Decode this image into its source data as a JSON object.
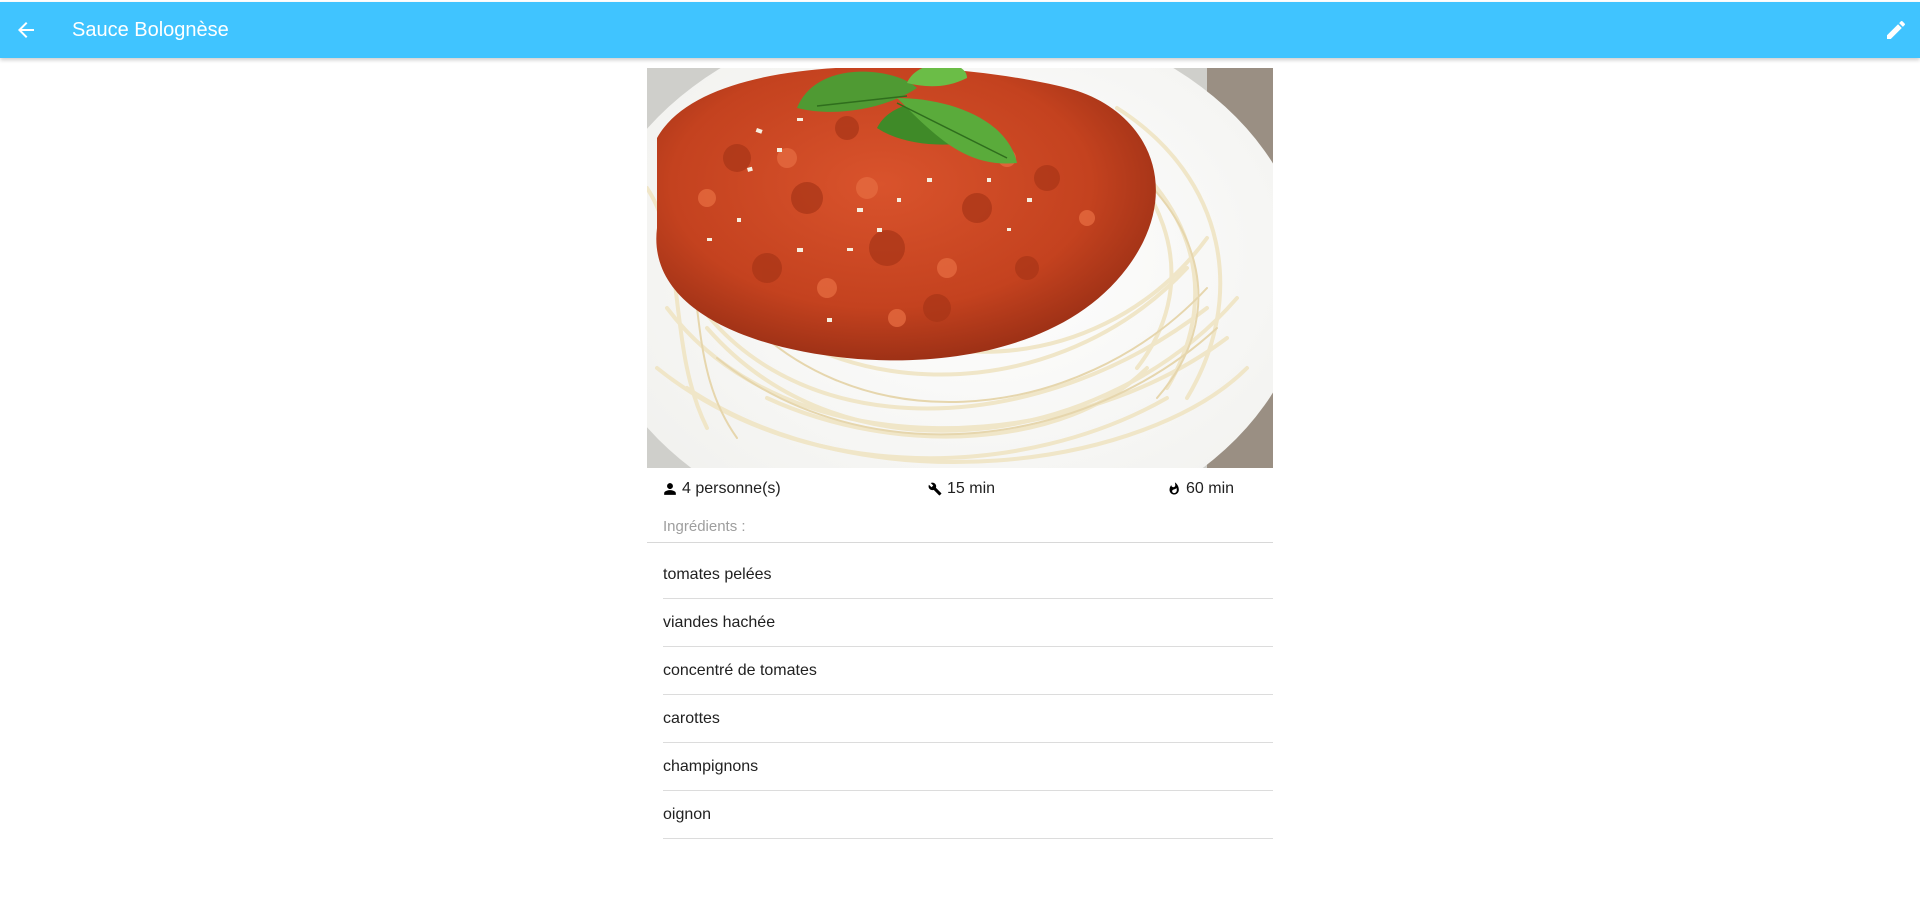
{
  "app_bar": {
    "title": "Sauce Bolognèse",
    "back_icon": "arrow-left-icon",
    "edit_icon": "pencil-icon",
    "color": "#40c4ff"
  },
  "recipe": {
    "photo_subject": "spaghetti bolognese with basil and grated parmesan",
    "servings": "4 personne(s)",
    "prep_time": "15 min",
    "cook_time": "60 min",
    "ingredients_label": "Ingrédients :",
    "ingredients": [
      "tomates pelées",
      "viandes hachée",
      "concentré de tomates",
      "carottes",
      "champignons",
      "oignon"
    ]
  }
}
